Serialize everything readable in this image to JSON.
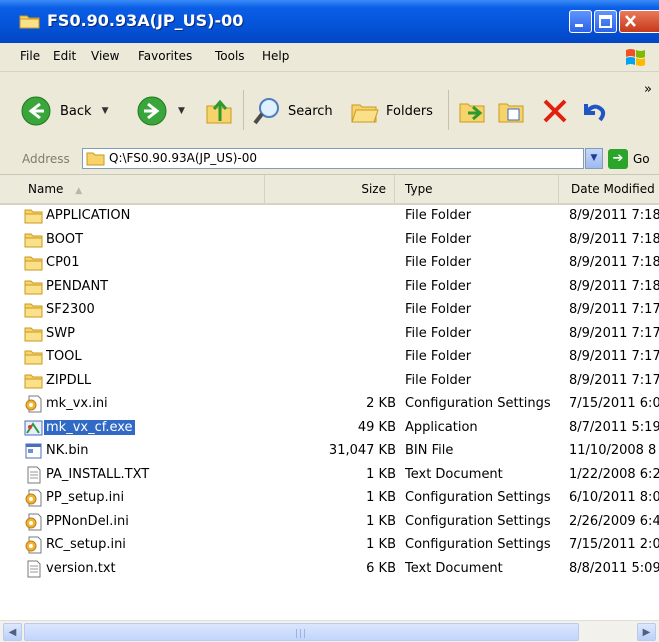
{
  "window": {
    "title": "FS0.90.93A(JP_US)-00"
  },
  "menu": [
    "File",
    "Edit",
    "View",
    "Favorites",
    "Tools",
    "Help"
  ],
  "toolbar": {
    "back_label": "Back",
    "search_label": "Search",
    "folders_label": "Folders",
    "overflow": "»"
  },
  "address": {
    "label": "Address",
    "value": "Q:\\FS0.90.93A(JP_US)-00",
    "go_label": "Go"
  },
  "columns": {
    "name": "Name",
    "size": "Size",
    "type": "Type",
    "date": "Date Modified"
  },
  "files": [
    {
      "name": "APPLICATION",
      "size": "",
      "type": "File Folder",
      "date": "8/9/2011 7:18",
      "icon": "folder-icon"
    },
    {
      "name": "BOOT",
      "size": "",
      "type": "File Folder",
      "date": "8/9/2011 7:18",
      "icon": "folder-icon"
    },
    {
      "name": "CP01",
      "size": "",
      "type": "File Folder",
      "date": "8/9/2011 7:18",
      "icon": "folder-icon"
    },
    {
      "name": "PENDANT",
      "size": "",
      "type": "File Folder",
      "date": "8/9/2011 7:18",
      "icon": "folder-icon"
    },
    {
      "name": "SF2300",
      "size": "",
      "type": "File Folder",
      "date": "8/9/2011 7:17",
      "icon": "folder-icon"
    },
    {
      "name": "SWP",
      "size": "",
      "type": "File Folder",
      "date": "8/9/2011 7:17",
      "icon": "folder-icon"
    },
    {
      "name": "TOOL",
      "size": "",
      "type": "File Folder",
      "date": "8/9/2011 7:17",
      "icon": "folder-icon"
    },
    {
      "name": "ZIPDLL",
      "size": "",
      "type": "File Folder",
      "date": "8/9/2011 7:17",
      "icon": "folder-icon"
    },
    {
      "name": "mk_vx.ini",
      "size": "2 KB",
      "type": "Configuration Settings",
      "date": "7/15/2011 6:0",
      "icon": "settings-file-icon"
    },
    {
      "name": "mk_vx_cf.exe",
      "size": "49 KB",
      "type": "Application",
      "date": "8/7/2011 5:19",
      "icon": "application-icon",
      "selected": true
    },
    {
      "name": "NK.bin",
      "size": "31,047 KB",
      "type": "BIN File",
      "date": "11/10/2008 8",
      "icon": "bin-file-icon"
    },
    {
      "name": "PA_INSTALL.TXT",
      "size": "1 KB",
      "type": "Text Document",
      "date": "1/22/2008 6:2",
      "icon": "text-file-icon"
    },
    {
      "name": "PP_setup.ini",
      "size": "1 KB",
      "type": "Configuration Settings",
      "date": "6/10/2011 8:0",
      "icon": "settings-file-icon"
    },
    {
      "name": "PPNonDel.ini",
      "size": "1 KB",
      "type": "Configuration Settings",
      "date": "2/26/2009 6:4",
      "icon": "settings-file-icon"
    },
    {
      "name": "RC_setup.ini",
      "size": "1 KB",
      "type": "Configuration Settings",
      "date": "7/15/2011 2:0",
      "icon": "settings-file-icon"
    },
    {
      "name": "version.txt",
      "size": "6 KB",
      "type": "Text Document",
      "date": "8/8/2011 5:09",
      "icon": "text-file-icon"
    }
  ],
  "colors": {
    "titlebar": "#0453d8",
    "selection": "#316ac5",
    "chrome": "#ece9d8"
  }
}
